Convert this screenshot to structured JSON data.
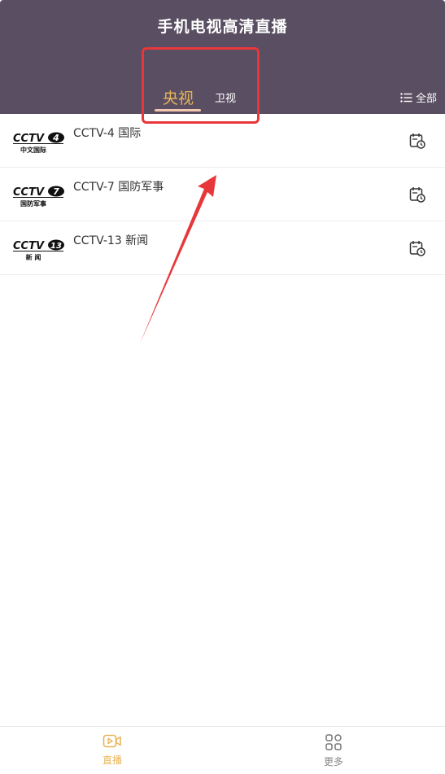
{
  "header": {
    "title": "手机电视高清直播",
    "tabs": [
      {
        "label": "央视",
        "active": true
      },
      {
        "label": "卫视",
        "active": false
      }
    ],
    "all_label": "全部",
    "all_icon": "list-icon",
    "background_color": "#5a4f62",
    "accent_color": "#e8b55a"
  },
  "channels": [
    {
      "name": "CCTV-4 国际",
      "logo": {
        "brand": "CCTV",
        "number": "4",
        "caption": "中文国际"
      },
      "action_icon": "calendar-clock-icon"
    },
    {
      "name": "CCTV-7 国防军事",
      "logo": {
        "brand": "CCTV",
        "number": "7",
        "caption": "国防军事"
      },
      "action_icon": "calendar-clock-icon"
    },
    {
      "name": "CCTV-13 新闻",
      "logo": {
        "brand": "CCTV",
        "number": "13",
        "caption": "新  闻"
      },
      "action_icon": "calendar-clock-icon"
    }
  ],
  "annotation": {
    "highlight_color": "#e8373a"
  },
  "bottom_nav": {
    "items": [
      {
        "label": "直播",
        "icon": "video-play-icon",
        "active": true
      },
      {
        "label": "更多",
        "icon": "grid-apps-icon",
        "active": false
      }
    ]
  }
}
